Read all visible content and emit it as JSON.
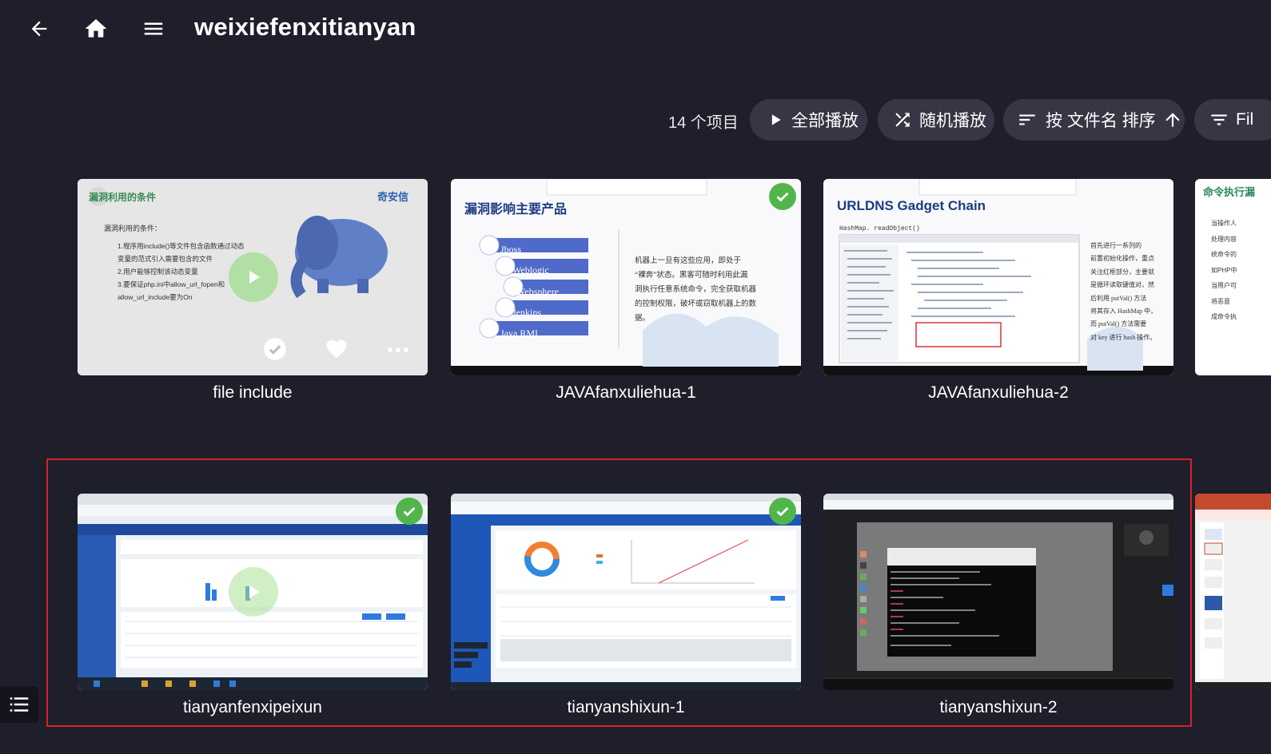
{
  "header": {
    "title": "weixiefenxitianyan",
    "back_icon": "arrow-left-icon",
    "home_icon": "home-icon",
    "menu_icon": "hamburger-menu-icon"
  },
  "toolbar": {
    "item_count": "14 个项目",
    "play_all_label": "全部播放",
    "shuffle_label": "随机播放",
    "sort_label": "按 文件名 排序",
    "filter_label": "Fil"
  },
  "colors": {
    "background": "#1f1e2b",
    "pill": "#373645",
    "check": "#52b54b",
    "selection_border": "#d9202a"
  },
  "videos": [
    {
      "title": "file include",
      "watched": false,
      "thumb": {
        "heading": "漏洞利用的条件",
        "brand": "奇安信",
        "subheading": "漏洞利用的条件：",
        "lines": [
          "1.程序用include()等文件包含函数通过动态",
          "变量的范式引入需要包含的文件",
          "2.用户能够控制该动态变量",
          "3.要保证php.ini中allow_url_fopen和",
          "allow_url_include要为On"
        ]
      }
    },
    {
      "title": "JAVAfanxuliehua-1",
      "watched": true,
      "thumb": {
        "heading": "漏洞影响主要产品",
        "products": [
          "Jboss",
          "Weblogic",
          "Websphere",
          "Jenkins",
          "Java RMI"
        ],
        "lines": [
          "机器上一旦有这些应用，即处于",
          "“裸奔”状态。黑客可随时利用此漏",
          "洞执行任意系统命令，完全获取机器",
          "的控制权限，破坏或窃取机器上的数",
          "据。"
        ]
      }
    },
    {
      "title": "JAVAfanxuliehua-2",
      "watched": false,
      "thumb": {
        "heading": "URLDNS Gadget Chain",
        "code_label": "HashMap. readObject()",
        "lines": [
          "首先进行一系列的",
          "前置初始化操作，重点",
          "关注红框部分，主要就",
          "是循环读取键值对，然",
          "后利用 putVal() 方法",
          "将其存入 HashMap 中，",
          "而 putVal() 方法需要",
          "对 key 进行 hash 操作。"
        ]
      }
    },
    {
      "title": "",
      "watched": false,
      "thumb": {
        "heading": "命令执行漏",
        "lines": [
          "当操作人",
          "处理内容",
          "统命令的",
          "如PHP中",
          "当用户可",
          "将恶意",
          "成命令执"
        ]
      }
    },
    {
      "title": "tianyanfenxipeixun",
      "watched": true
    },
    {
      "title": "tianyanshixun-1",
      "watched": true
    },
    {
      "title": "tianyanshixun-2",
      "watched": false
    },
    {
      "title": "",
      "watched": false
    }
  ],
  "hover_actions": {
    "check_icon": "check-circle-icon",
    "favorite_icon": "heart-icon",
    "more_icon": "more-dots-icon"
  },
  "footer": {
    "list_icon": "list-icon"
  }
}
